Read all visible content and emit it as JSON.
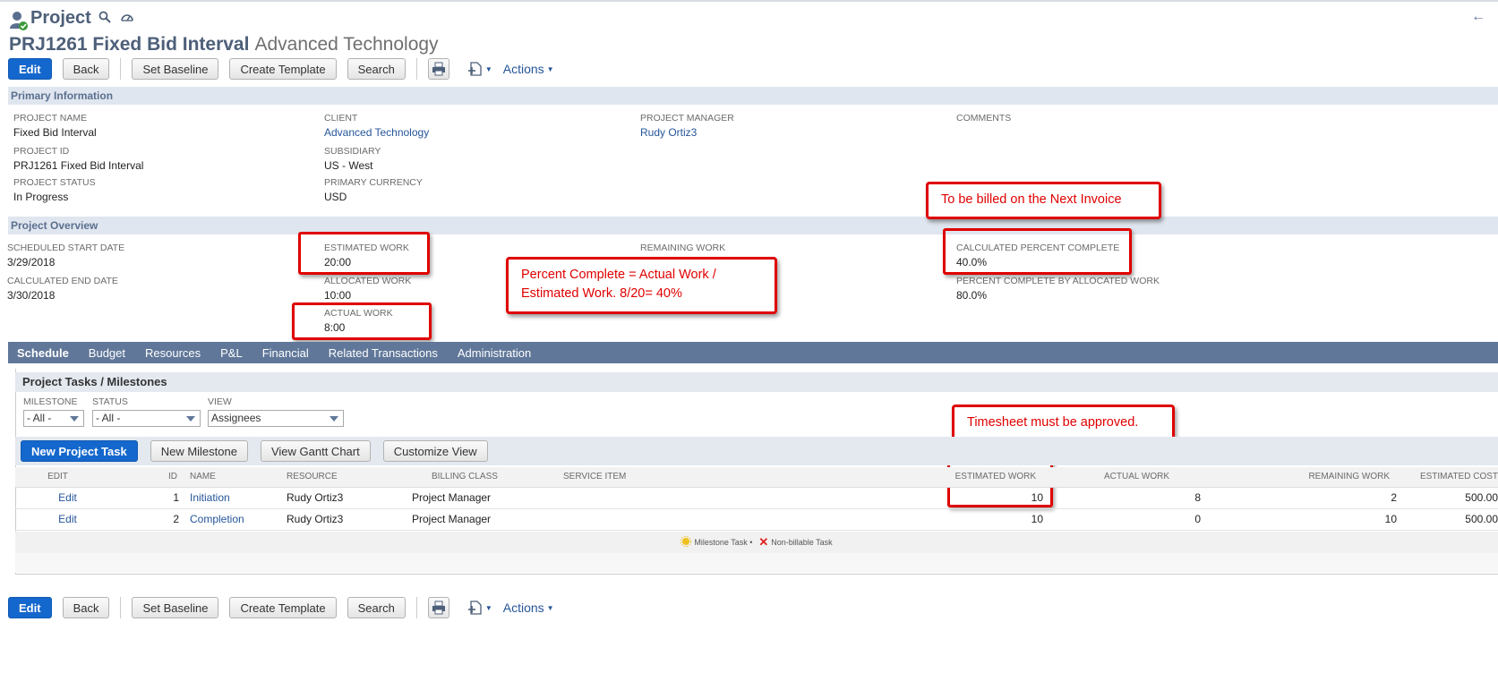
{
  "header": {
    "record_type": "Project",
    "record_id": "PRJ1261 Fixed Bid Interval",
    "record_subtitle": "Advanced Technology"
  },
  "toolbar": {
    "edit": "Edit",
    "back": "Back",
    "set_baseline": "Set Baseline",
    "create_template": "Create Template",
    "search": "Search",
    "actions": "Actions"
  },
  "primary_info": {
    "section_title": "Primary Information",
    "project_name_label": "PROJECT NAME",
    "project_name": "Fixed Bid Interval",
    "project_id_label": "PROJECT ID",
    "project_id": "PRJ1261 Fixed Bid Interval",
    "project_status_label": "PROJECT STATUS",
    "project_status": "In Progress",
    "client_label": "CLIENT",
    "client": "Advanced Technology",
    "subsidiary_label": "SUBSIDIARY",
    "subsidiary": "US - West",
    "primary_currency_label": "PRIMARY CURRENCY",
    "primary_currency": "USD",
    "project_manager_label": "PROJECT MANAGER",
    "project_manager": "Rudy Ortiz3",
    "comments_label": "COMMENTS"
  },
  "overview": {
    "section_title": "Project Overview",
    "sched_start_label": "SCHEDULED START DATE",
    "sched_start": "3/29/2018",
    "calc_end_label": "CALCULATED END DATE",
    "calc_end": "3/30/2018",
    "est_work_label": "ESTIMATED WORK",
    "est_work": "20:00",
    "alloc_work_label": "ALLOCATED WORK",
    "alloc_work": "10:00",
    "actual_work_label": "ACTUAL WORK",
    "actual_work": "8:00",
    "remaining_work_label": "REMAINING WORK",
    "calc_pct_label": "CALCULATED PERCENT COMPLETE",
    "calc_pct": "40.0%",
    "pct_alloc_label": "PERCENT COMPLETE BY ALLOCATED WORK",
    "pct_alloc": "80.0%"
  },
  "annotations": {
    "billed": "To be billed on the Next Invoice",
    "percent_line1": "Percent Complete = Actual Work /",
    "percent_line2": "Estimated Work.  8/20= 40%",
    "timesheet": "Timesheet must be approved."
  },
  "tabs": [
    "Schedule",
    "Budget",
    "Resources",
    "P&L",
    "Financial",
    "Related Transactions",
    "Administration"
  ],
  "schedule": {
    "title": "Project Tasks / Milestones",
    "milestone_label": "MILESTONE",
    "milestone_value": "- All -",
    "status_label": "STATUS",
    "status_value": "- All -",
    "view_label": "VIEW",
    "view_value": "Assignees",
    "new_task": "New Project Task",
    "new_milestone": "New Milestone",
    "gantt": "View Gantt Chart",
    "customize": "Customize View",
    "columns": [
      "EDIT",
      "ID",
      "NAME",
      "RESOURCE",
      "BILLING CLASS",
      "SERVICE ITEM",
      "ESTIMATED WORK",
      "ACTUAL WORK",
      "REMAINING WORK",
      "ESTIMATED COST"
    ],
    "rows": [
      {
        "edit": "Edit",
        "id": "1",
        "name": "Initiation",
        "resource": "Rudy Ortiz3",
        "billing": "Project Manager",
        "service": "",
        "est": "10",
        "actual": "8",
        "remaining": "2",
        "cost": "500.00"
      },
      {
        "edit": "Edit",
        "id": "2",
        "name": "Completion",
        "resource": "Rudy Ortiz3",
        "billing": "Project Manager",
        "service": "",
        "est": "10",
        "actual": "0",
        "remaining": "10",
        "cost": "500.00"
      }
    ],
    "legend_milestone": "Milestone Task •",
    "legend_nonbillable": "Non-billable Task"
  },
  "colors": {
    "accent": "#1467cc",
    "tabbar": "#607799",
    "annotation": "#e00000",
    "link": "#255599"
  }
}
